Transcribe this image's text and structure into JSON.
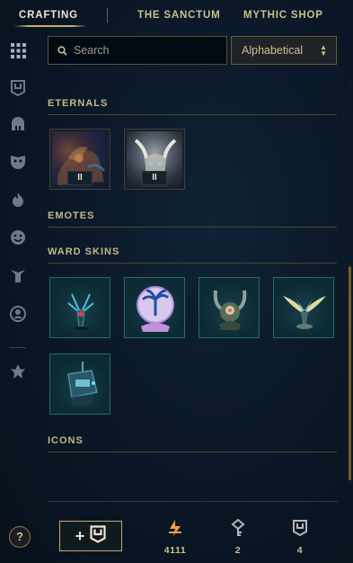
{
  "nav": {
    "tabs": [
      {
        "label": "CRAFTING",
        "active": true
      },
      {
        "label": "THE SANCTUM",
        "active": false
      },
      {
        "label": "MYTHIC SHOP",
        "active": false
      }
    ]
  },
  "sidebar": {
    "icons": [
      "grid-icon",
      "chest-icon",
      "helmet-icon",
      "mask-icon",
      "flame-icon",
      "emote-face-icon",
      "ward-icon",
      "profile-icon-icon",
      "tft-icon"
    ]
  },
  "search": {
    "placeholder": "Search",
    "value": ""
  },
  "sort": {
    "selected": "Alphabetical"
  },
  "sections": {
    "eternals": {
      "title": "ETERNALS",
      "items": [
        {
          "champion": "eternal-1",
          "level": "II"
        },
        {
          "champion": "eternal-2",
          "level": "II"
        }
      ]
    },
    "emotes": {
      "title": "EMOTES"
    },
    "ward_skins": {
      "title": "WARD SKINS",
      "items": [
        "ward-skin-1",
        "ward-skin-2",
        "ward-skin-3",
        "ward-skin-4",
        "ward-skin-5"
      ]
    },
    "icons": {
      "title": "ICONS"
    }
  },
  "bottom": {
    "help_label": "?",
    "add_label": "+",
    "currencies": [
      {
        "icon": "orange-essence-icon",
        "amount": "4111",
        "color": "#f0a040"
      },
      {
        "icon": "key-icon",
        "amount": "2",
        "color": "#b8b8b8"
      },
      {
        "icon": "chest-icon",
        "amount": "4",
        "color": "#b8b8b8"
      }
    ]
  },
  "colors": {
    "gold": "#c8aa6e",
    "text": "#cdbe91",
    "teal_border": "#2f6868",
    "background": "#0a1726"
  }
}
